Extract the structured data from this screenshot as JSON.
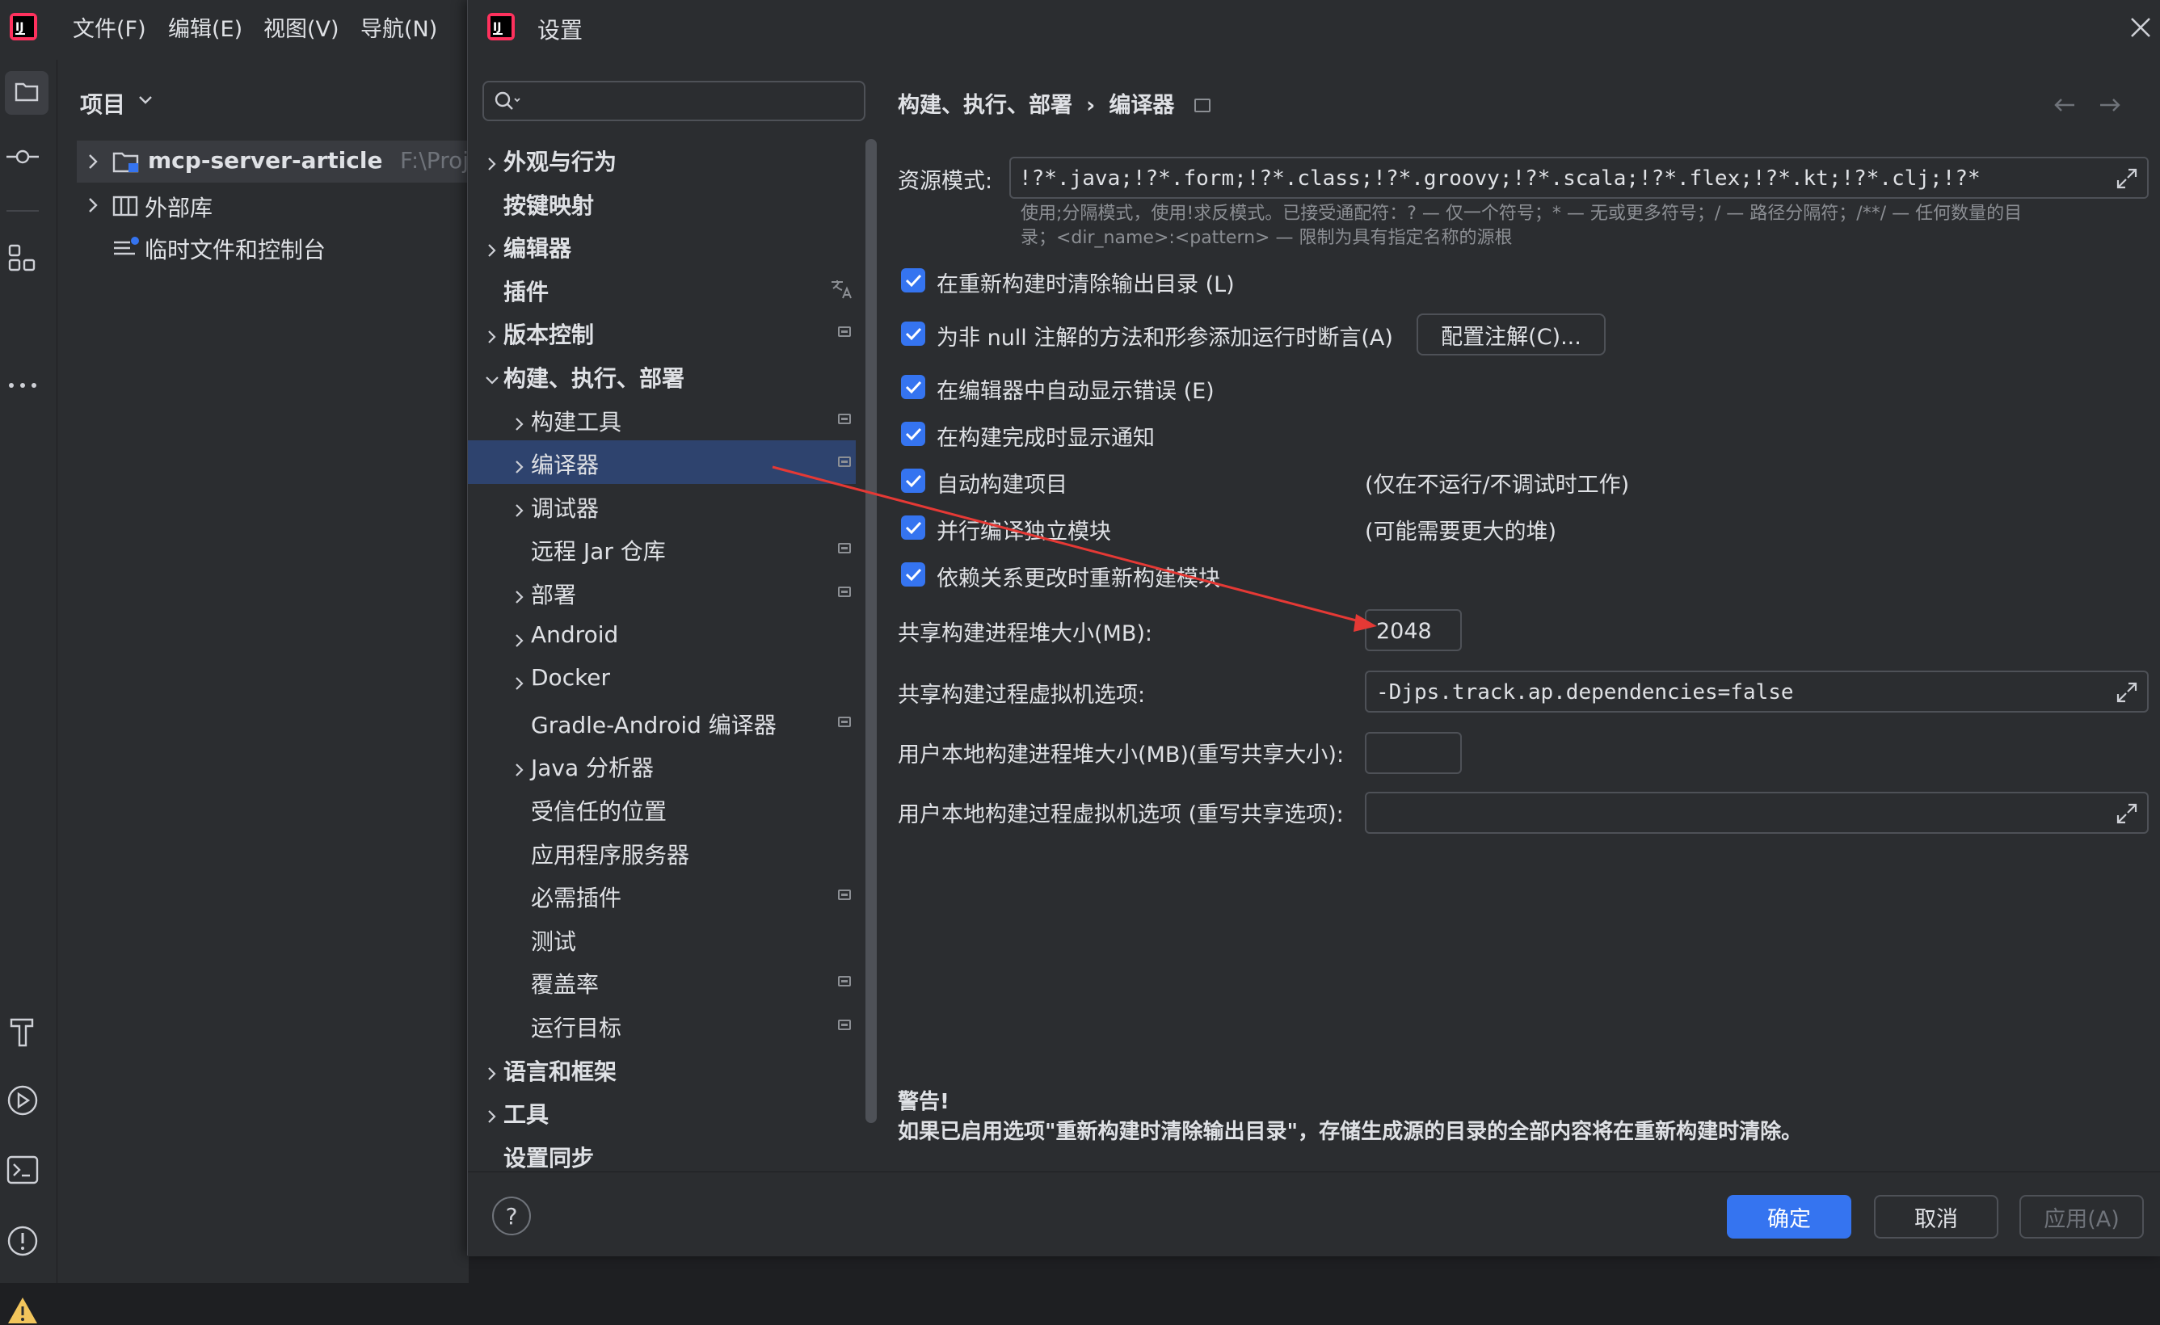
{
  "ide": {
    "menu": [
      "文件(F)",
      "编辑(E)",
      "视图(V)",
      "导航(N)"
    ],
    "project_label": "项目",
    "tree": {
      "project_name": "mcp-server-article",
      "project_path": "F:\\Proje",
      "external_libs": "外部库",
      "scratches": "临时文件和控制台"
    }
  },
  "dialog": {
    "title": "设置",
    "search_placeholder": "",
    "breadcrumb": {
      "parent": "构建、执行、部署",
      "sep": "›",
      "current": "编译器"
    },
    "nav": [
      {
        "label": "外观与行为",
        "level": 0,
        "chevron": "right",
        "bold": true,
        "badge": false
      },
      {
        "label": "按键映射",
        "level": 0,
        "chevron": "none",
        "bold": true,
        "badge": false
      },
      {
        "label": "编辑器",
        "level": 0,
        "chevron": "right",
        "bold": true,
        "badge": false
      },
      {
        "label": "插件",
        "level": 0,
        "chevron": "none",
        "bold": true,
        "badge": false,
        "translate_icon": true
      },
      {
        "label": "版本控制",
        "level": 0,
        "chevron": "right",
        "bold": true,
        "badge": true
      },
      {
        "label": "构建、执行、部署",
        "level": 0,
        "chevron": "down",
        "bold": true,
        "badge": false
      },
      {
        "label": "构建工具",
        "level": 1,
        "chevron": "right",
        "badge": true
      },
      {
        "label": "编译器",
        "level": 1,
        "chevron": "right",
        "badge": true,
        "selected": true
      },
      {
        "label": "调试器",
        "level": 1,
        "chevron": "right",
        "badge": false
      },
      {
        "label": "远程 Jar 仓库",
        "level": 1,
        "chevron": "none",
        "badge": true
      },
      {
        "label": "部署",
        "level": 1,
        "chevron": "right",
        "badge": true
      },
      {
        "label": "Android",
        "level": 1,
        "chevron": "right",
        "badge": false
      },
      {
        "label": "Docker",
        "level": 1,
        "chevron": "right",
        "badge": false
      },
      {
        "label": "Gradle-Android 编译器",
        "level": 1,
        "chevron": "none",
        "badge": true
      },
      {
        "label": "Java 分析器",
        "level": 1,
        "chevron": "right",
        "badge": false
      },
      {
        "label": "受信任的位置",
        "level": 1,
        "chevron": "none",
        "badge": false
      },
      {
        "label": "应用程序服务器",
        "level": 1,
        "chevron": "none",
        "badge": false
      },
      {
        "label": "必需插件",
        "level": 1,
        "chevron": "none",
        "badge": true
      },
      {
        "label": "测试",
        "level": 1,
        "chevron": "none",
        "badge": false
      },
      {
        "label": "覆盖率",
        "level": 1,
        "chevron": "none",
        "badge": true
      },
      {
        "label": "运行目标",
        "level": 1,
        "chevron": "none",
        "badge": true
      },
      {
        "label": "语言和框架",
        "level": 0,
        "chevron": "right",
        "bold": true,
        "badge": false
      },
      {
        "label": "工具",
        "level": 0,
        "chevron": "right",
        "bold": true,
        "badge": false
      },
      {
        "label": "设置同步",
        "level": 0,
        "chevron": "none",
        "bold": true,
        "badge": false
      }
    ],
    "resource_patterns": {
      "label": "资源模式:",
      "value": "!?*.java;!?*.form;!?*.class;!?*.groovy;!?*.scala;!?*.flex;!?*.kt;!?*.clj;!?*",
      "hint_line1": "使用;分隔模式，使用!求反模式。已接受通配符：? — 仅一个符号；* — 无或更多符号；/ — 路径分隔符；/**/ — 任何数量的目",
      "hint_line2": "录；<dir_name>:<pattern> — 限制为具有指定名称的源根"
    },
    "options": [
      {
        "label": "在重新构建时清除输出目录 (L)",
        "checked": true
      },
      {
        "label": "为非 null 注解的方法和形参添加运行时断言(A)",
        "checked": true,
        "button": "配置注解(C)..."
      },
      {
        "label": "在编辑器中自动显示错误 (E)",
        "checked": true
      },
      {
        "label": "在构建完成时显示通知",
        "checked": true
      },
      {
        "label": "自动构建项目",
        "checked": true,
        "note": "(仅在不运行/不调试时工作)"
      },
      {
        "label": "并行编译独立模块",
        "checked": true,
        "note": "(可能需要更大的堆)"
      },
      {
        "label": "依赖关系更改时重新构建模块",
        "checked": true
      }
    ],
    "shared_heap": {
      "label": "共享构建进程堆大小(MB):",
      "value": "2048"
    },
    "shared_vm": {
      "label": "共享构建过程虚拟机选项:",
      "value": "-Djps.track.ap.dependencies=false"
    },
    "user_heap": {
      "label": "用户本地构建进程堆大小(MB)(重写共享大小):",
      "value": ""
    },
    "user_vm": {
      "label": "用户本地构建过程虚拟机选项 (重写共享选项):",
      "value": ""
    },
    "warning": {
      "title": "警告!",
      "text": "如果已启用选项\"重新构建时清除输出目录\"，存储生成源的目录的全部内容将在重新构建时清除。"
    },
    "buttons": {
      "ok": "确定",
      "cancel": "取消",
      "apply": "应用(A)",
      "help": "?"
    }
  },
  "colors": {
    "accent": "#3574f0",
    "selection": "#2e436e",
    "annotation_arrow": "#e53935",
    "warning_icon": "#f2c55c"
  }
}
